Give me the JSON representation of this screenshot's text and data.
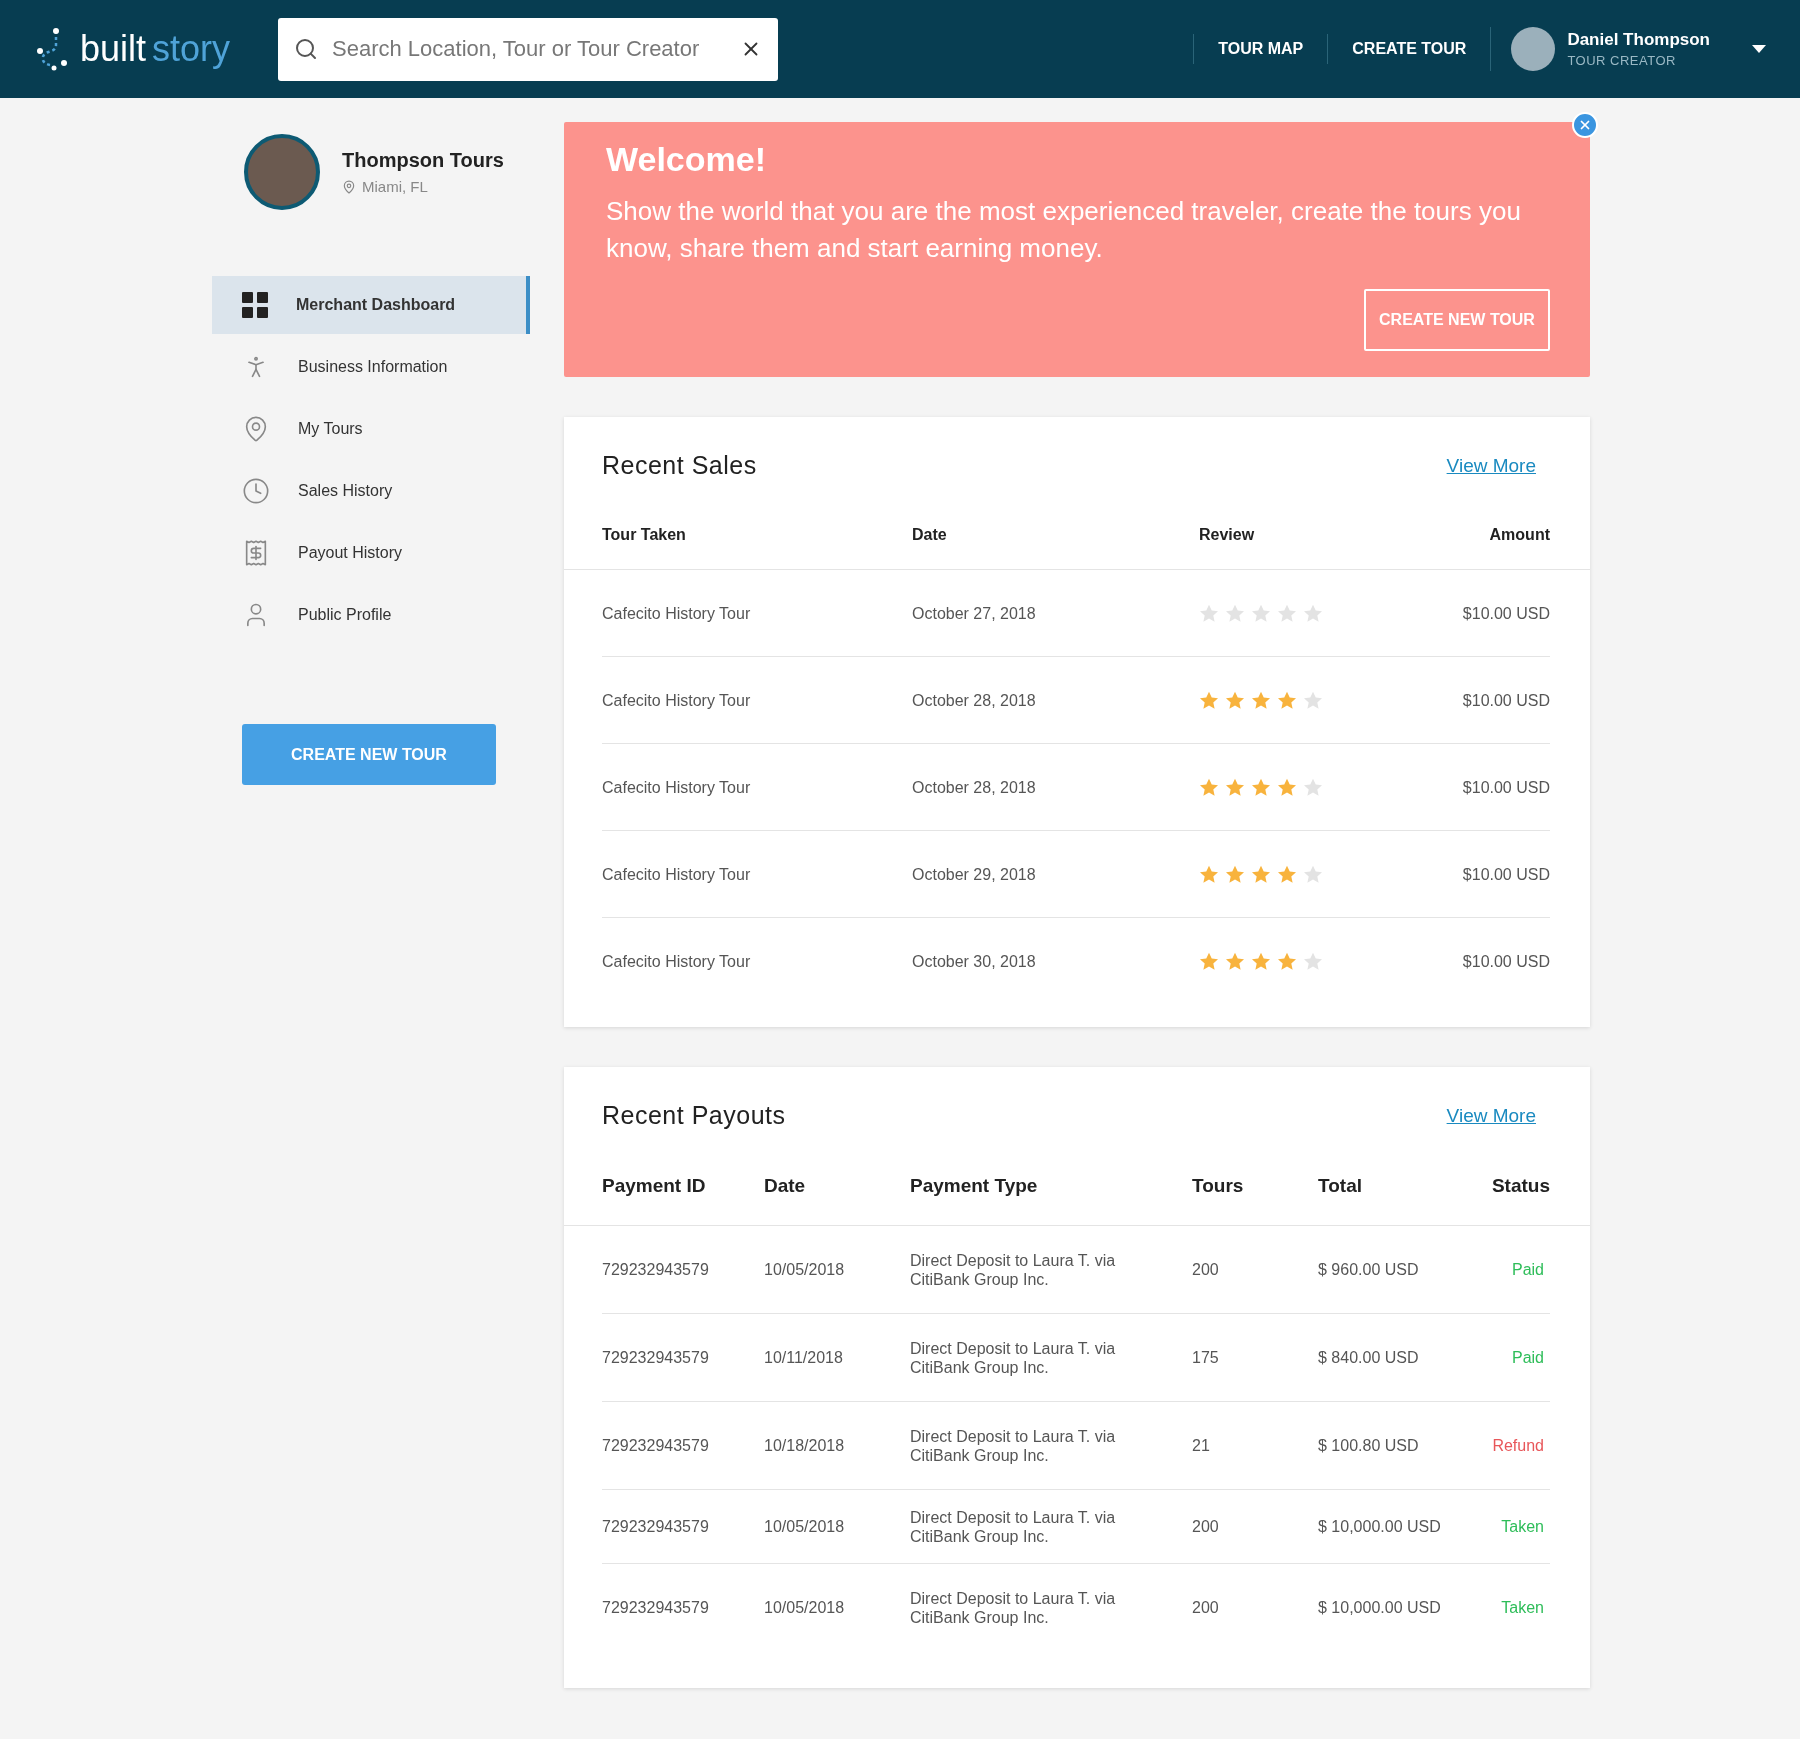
{
  "header": {
    "logo": {
      "part_1": "built",
      "part_2": "story"
    },
    "search": {
      "placeholder": "Search Location, Tour or Tour Creator"
    },
    "nav": [
      "TOUR MAP",
      "CREATE TOUR"
    ],
    "user": {
      "name": "Daniel Thompson",
      "role": "TOUR CREATOR"
    }
  },
  "sidebar": {
    "profile": {
      "name": "Thompson Tours",
      "location": "Miami, FL"
    },
    "items": [
      {
        "label": "Merchant Dashboard",
        "selected": true
      },
      {
        "label": "Business Information",
        "selected": false
      },
      {
        "label": "My Tours",
        "selected": false
      },
      {
        "label": "Sales History",
        "selected": false
      },
      {
        "label": "Payout History",
        "selected": false
      },
      {
        "label": "Public Profile",
        "selected": false
      }
    ],
    "button": "CREATE NEW TOUR"
  },
  "banner": {
    "title": "Welcome!",
    "text": "Show the world that you are the most experienced traveler, create the tours you know, share them and start earning money.",
    "button": "CREATE NEW TOUR"
  },
  "recent_sales": {
    "title": "Recent Sales",
    "link": "View More",
    "columns": [
      "Tour Taken",
      "Date",
      "Review",
      "Amount"
    ],
    "rows": [
      {
        "tour": "Cafecito History Tour",
        "date": "October 27, 2018",
        "stars": 0,
        "amount": "$10.00 USD"
      },
      {
        "tour": "Cafecito History Tour",
        "date": "October 28, 2018",
        "stars": 4,
        "amount": "$10.00 USD"
      },
      {
        "tour": "Cafecito History Tour",
        "date": "October 28, 2018",
        "stars": 4,
        "amount": "$10.00 USD"
      },
      {
        "tour": "Cafecito History Tour",
        "date": "October 29, 2018",
        "stars": 4,
        "amount": "$10.00 USD"
      },
      {
        "tour": "Cafecito History Tour",
        "date": "October 30, 2018",
        "stars": 4,
        "amount": "$10.00 USD"
      }
    ]
  },
  "recent_payouts": {
    "title": "Recent Payouts",
    "link": "View More",
    "columns": [
      "Payment ID",
      "Date",
      "Payment Type",
      "Tours",
      "Total",
      "Status"
    ],
    "rows": [
      {
        "id": "729232943579",
        "date": "10/05/2018",
        "type": "Direct Deposit to Laura T. via CitiBank Group Inc.",
        "tours": "200",
        "total": "$ 960.00 USD",
        "status": "Paid",
        "color": "#2ebd59"
      },
      {
        "id": "729232943579",
        "date": "10/11/2018",
        "type": "Direct Deposit to Laura T. via CitiBank Group Inc.",
        "tours": "175",
        "total": "$ 840.00 USD",
        "status": "Paid",
        "color": "#2ebd59"
      },
      {
        "id": "729232943579",
        "date": "10/18/2018",
        "type": "Direct Deposit to Laura T. via CitiBank Group Inc.",
        "tours": "21",
        "total": "$ 100.80 USD",
        "status": "Refund",
        "color": "#e8575a"
      },
      {
        "id": "729232943579",
        "date": "10/05/2018",
        "type": "Direct Deposit to Laura T. via CitiBank Group Inc.",
        "tours": "200",
        "total": "$ 10,000.00 USD",
        "status": "Taken",
        "color": "#2ebd59"
      },
      {
        "id": "729232943579",
        "date": "10/05/2018",
        "type": "Direct Deposit to Laura T. via CitiBank Group Inc.",
        "tours": "200",
        "total": "$ 10,000.00 USD",
        "status": "Taken",
        "color": "#2ebd59"
      }
    ]
  }
}
